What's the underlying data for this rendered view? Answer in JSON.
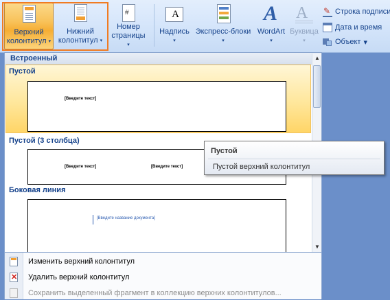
{
  "ribbon": {
    "header_btn": {
      "line1": "Верхний",
      "line2": "колонтитул"
    },
    "footer_btn": {
      "line1": "Нижний",
      "line2": "колонтитул"
    },
    "pagenum_btn": {
      "line1": "Номер",
      "line2": "страницы"
    },
    "textbox_btn": {
      "line1": "Надпись"
    },
    "quickparts_btn": {
      "line1": "Экспресс-блоки"
    },
    "wordart_btn": {
      "line1": "WordArt"
    },
    "dropcap_btn": {
      "line1": "Буквица"
    },
    "signature_line": "Строка подписи",
    "date_time": "Дата и время",
    "object": "Объект",
    "caret": "▾"
  },
  "gallery": {
    "header": "Встроенный",
    "items": [
      {
        "title": "Пустой",
        "placeholders": [
          "[Введите текст]"
        ]
      },
      {
        "title": "Пустой (3 столбца)",
        "placeholders": [
          "[Введите текст]",
          "[Введите текст]"
        ]
      },
      {
        "title": "Боковая линия",
        "placeholders": [
          "[Введите название документа]"
        ]
      }
    ]
  },
  "tooltip": {
    "title": "Пустой",
    "description": "Пустой верхний колонтитул"
  },
  "menu": {
    "edit": "Изменить верхний колонтитул",
    "delete": "Удалить верхний колонтитул",
    "save": "Сохранить выделенный фрагмент в коллекцию верхних колонтитулов..."
  },
  "colors": {
    "accent_orange": "#f07b22",
    "highlight": "#ffd567",
    "ribbon_text": "#15428b"
  }
}
